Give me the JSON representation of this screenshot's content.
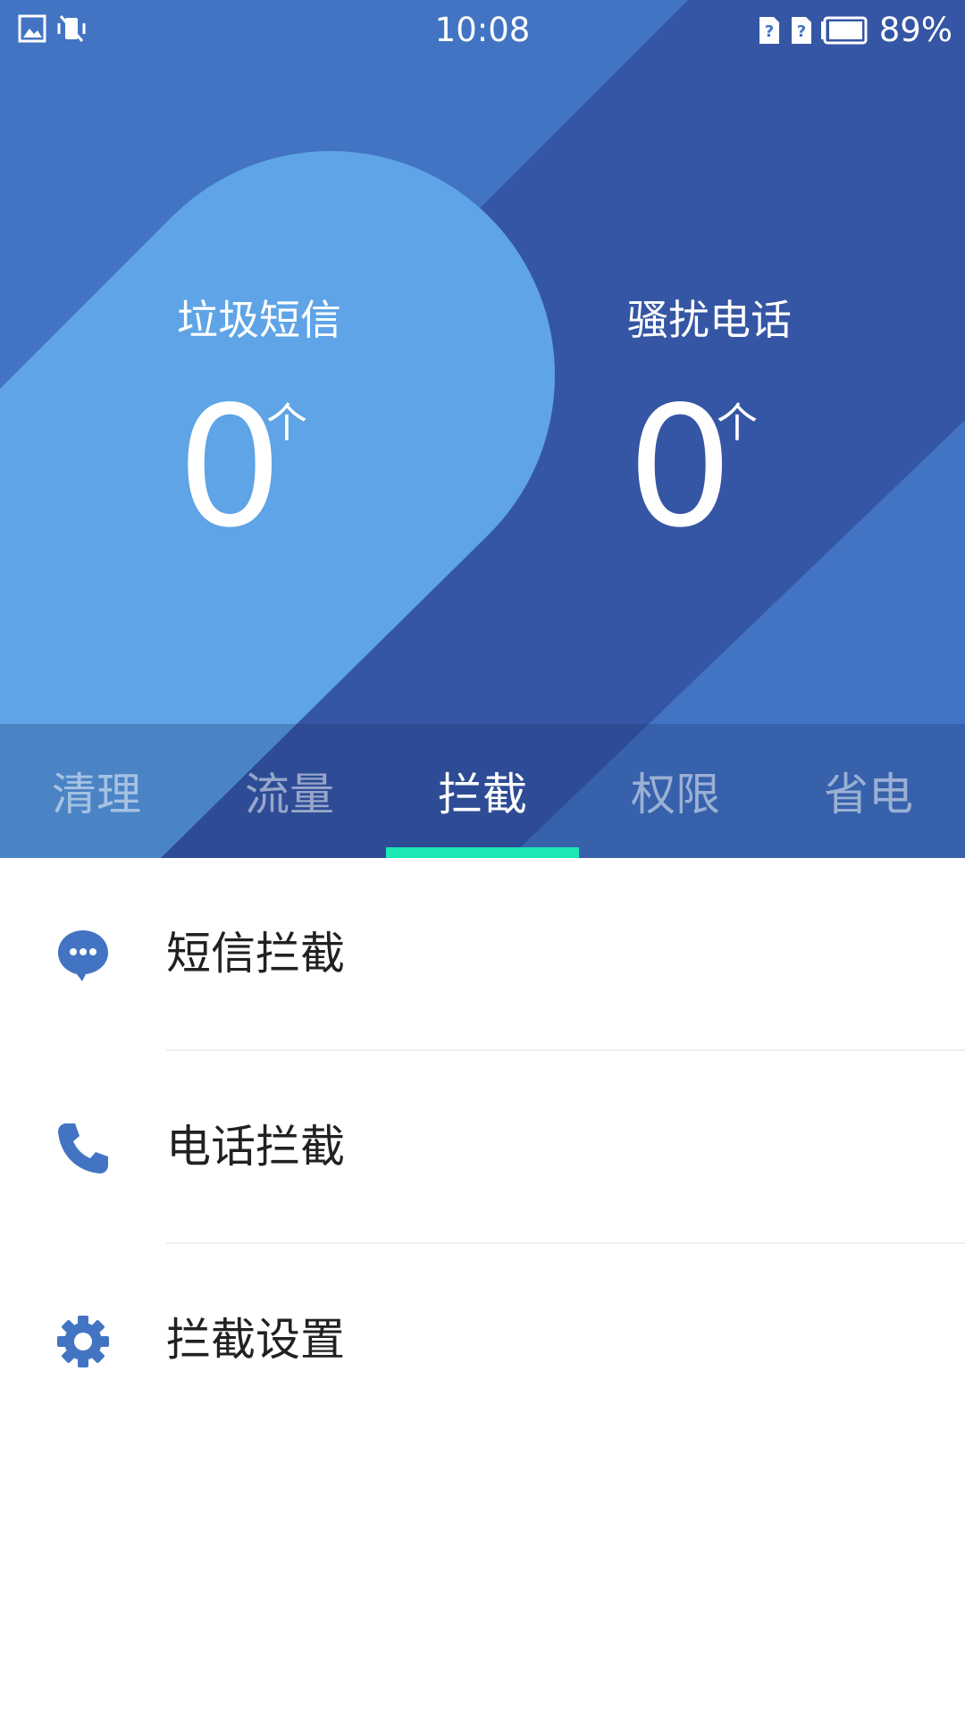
{
  "status_bar": {
    "time": "10:08",
    "battery": "89%",
    "icons_left": [
      "image-icon",
      "vibrate-silent-icon"
    ],
    "icons_right": [
      "sim1-unknown-icon",
      "sim2-unknown-icon",
      "battery-icon"
    ]
  },
  "summary": {
    "sms": {
      "label": "垃圾短信",
      "value": "0",
      "unit": "个"
    },
    "call": {
      "label": "骚扰电话",
      "value": "0",
      "unit": "个"
    }
  },
  "tabs": [
    {
      "label": "清理",
      "active": false
    },
    {
      "label": "流量",
      "active": false
    },
    {
      "label": "拦截",
      "active": true
    },
    {
      "label": "权限",
      "active": false
    },
    {
      "label": "省电",
      "active": false
    }
  ],
  "list": [
    {
      "label": "短信拦截",
      "icon": "message-icon"
    },
    {
      "label": "电话拦截",
      "icon": "phone-icon"
    },
    {
      "label": "拦截设置",
      "icon": "gear-icon"
    }
  ],
  "colors": {
    "header_base": "#4274c3",
    "header_dark": "#3556a4",
    "header_light": "#5ea4e6",
    "tab_indicator": "#1de9b6",
    "icon_blue": "#4274c3"
  }
}
